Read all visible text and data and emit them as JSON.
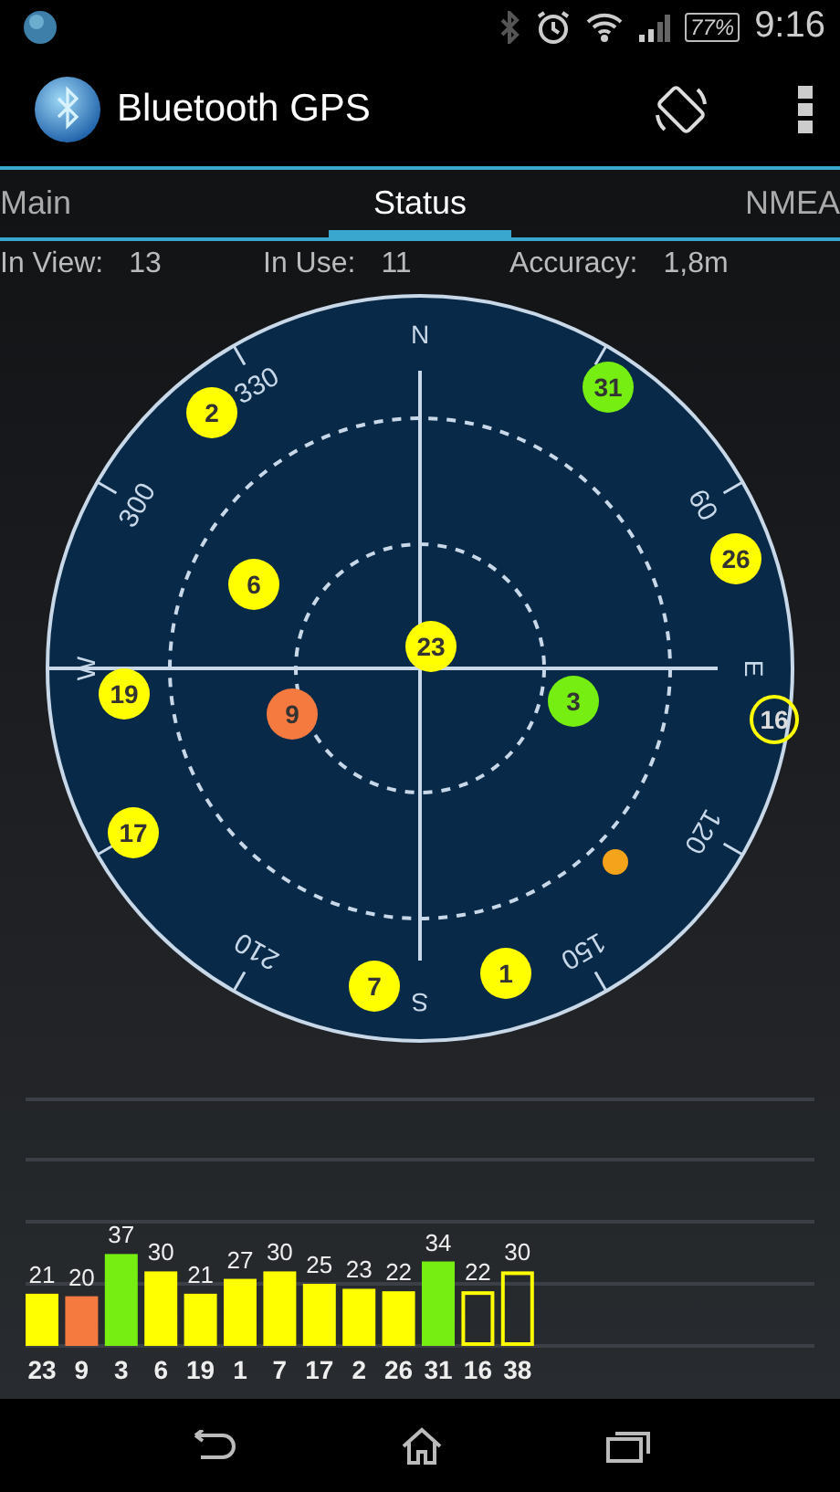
{
  "status_bar": {
    "battery": "77%",
    "time": "9:16"
  },
  "action_bar": {
    "title": "Bluetooth GPS"
  },
  "tabs": [
    {
      "label": "Main",
      "selected": false
    },
    {
      "label": "Status",
      "selected": true
    },
    {
      "label": "NMEA",
      "selected": false
    }
  ],
  "summary": [
    {
      "label": "In View:",
      "value": "13"
    },
    {
      "label": "In Use:",
      "value": "11"
    },
    {
      "label": "Accuracy:",
      "value": "1,8m"
    }
  ],
  "sky_plot": {
    "compass_labels": [
      "N",
      "E",
      "S",
      "W"
    ],
    "degree_labels": [
      "60",
      "120",
      "150",
      "210",
      "300",
      "330"
    ],
    "satellites": [
      {
        "prn": "2",
        "color": "#ffff00",
        "used": true
      },
      {
        "prn": "31",
        "color": "#77ee11",
        "used": true
      },
      {
        "prn": "6",
        "color": "#ffff00",
        "used": true
      },
      {
        "prn": "26",
        "color": "#ffff00",
        "used": true
      },
      {
        "prn": "23",
        "color": "#ffff00",
        "used": true
      },
      {
        "prn": "19",
        "color": "#ffff00",
        "used": true
      },
      {
        "prn": "9",
        "color": "#f47a40",
        "used": true
      },
      {
        "prn": "3",
        "color": "#77ee11",
        "used": true
      },
      {
        "prn": "16",
        "color": "#ffff00",
        "used": false
      },
      {
        "prn": "17",
        "color": "#ffff00",
        "used": true
      },
      {
        "prn": "7",
        "color": "#ffff00",
        "used": true
      },
      {
        "prn": "1",
        "color": "#ffff00",
        "used": true
      }
    ],
    "unlabeled_marks": [
      {
        "color": "#f5a31a"
      }
    ]
  },
  "signal_chart": {
    "chart_data": {
      "type": "bar",
      "categories": [
        "23",
        "9",
        "3",
        "6",
        "19",
        "1",
        "7",
        "17",
        "2",
        "26",
        "31",
        "16",
        "38"
      ],
      "series": [
        {
          "values": [
            21,
            20,
            37,
            30,
            21,
            27,
            30,
            25,
            23,
            22,
            34,
            22,
            30
          ]
        }
      ],
      "data_labels": true
    },
    "bar_styles": [
      {
        "color": "#ffff00",
        "used": true
      },
      {
        "color": "#f47a40",
        "used": true
      },
      {
        "color": "#77ee11",
        "used": true
      },
      {
        "color": "#ffff00",
        "used": true
      },
      {
        "color": "#ffff00",
        "used": true
      },
      {
        "color": "#ffff00",
        "used": true
      },
      {
        "color": "#ffff00",
        "used": true
      },
      {
        "color": "#ffff00",
        "used": true
      },
      {
        "color": "#ffff00",
        "used": true
      },
      {
        "color": "#ffff00",
        "used": true
      },
      {
        "color": "#77ee11",
        "used": true
      },
      {
        "color": "#ffff00",
        "used": false
      },
      {
        "color": "#ffff00",
        "used": false
      }
    ]
  }
}
